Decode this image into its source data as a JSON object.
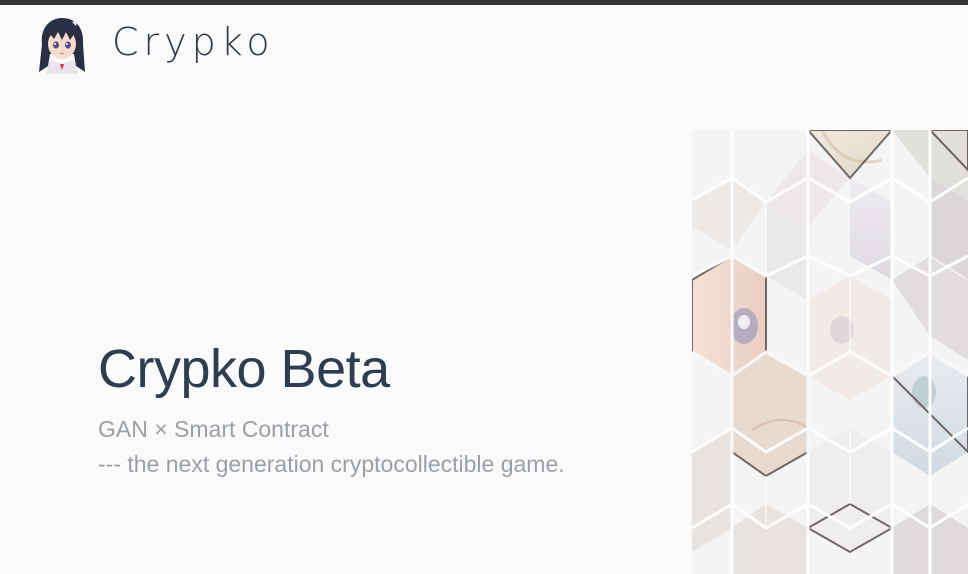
{
  "header": {
    "logo_icon": "anime-girl-avatar-icon",
    "brand_name": "Crypko"
  },
  "hero": {
    "title": "Crypko Beta",
    "subtitle": "GAN × Smart Contract",
    "tagline": "--- the next generation cryptocollectible game."
  },
  "art": {
    "icon": "hexagon-mosaic-anime-art"
  },
  "colors": {
    "background": "#fafafa",
    "top_rule": "#333333",
    "title": "#2c3e50",
    "subtitle": "#9aa0a6"
  }
}
